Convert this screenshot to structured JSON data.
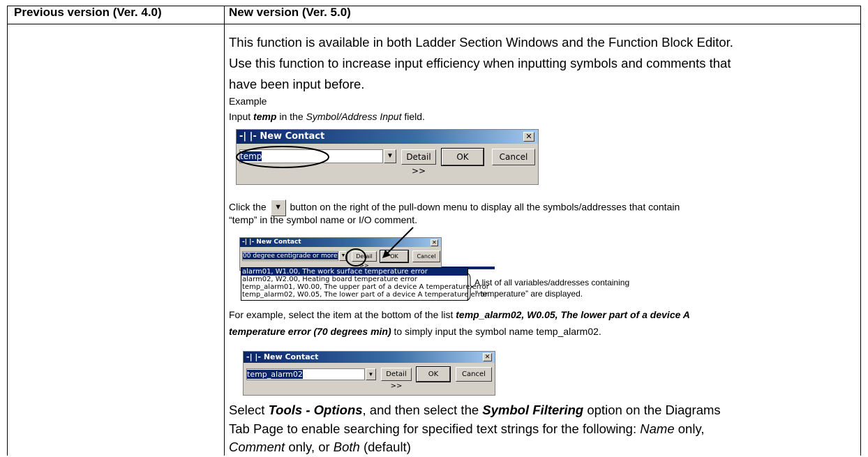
{
  "table": {
    "col_previous": "Previous version (Ver. 4.0)",
    "col_new": "New version (Ver. 5.0)"
  },
  "content": {
    "intro_line1": "This function is available in both Ladder Section Windows and the Function Block Editor.",
    "intro_line2": "Use this function to increase input efficiency when inputting symbols and comments that",
    "intro_line3": "have been input before.",
    "example_label": "Example",
    "input_prefix": "Input ",
    "input_term": "temp",
    "input_mid": " in the ",
    "input_field": "Symbol/Address Input",
    "input_suffix": " field.",
    "click_prefix": "Click the",
    "click_suffix": "button on the right of the pull-down menu to display all the symbols/addresses that contain",
    "click_line2": "“temp” in the symbol name or I/O comment.",
    "list_note_line1": "A list of all variables/addresses containing",
    "list_note_line2": "“ temperature” are displayed.",
    "select_prefix": "For example, select the item at the bottom of the list ",
    "select_bold1": "temp_alarm02, W0.05, The lower part of a device A",
    "select_bold2": "temperature error (70 degrees min)",
    "select_suffix": " to simply input the symbol name temp_alarm02.",
    "tools_prefix": "Select ",
    "tools_bold": "Tools - Options",
    "tools_mid": ", and then select the ",
    "tools_bold2": "Symbol Filtering",
    "tools_suffix": " option on the Diagrams",
    "tab_line": "Tab Page to enable searching for specified text strings for the following: ",
    "name_word": "Name",
    "only1": " only,",
    "comment_word": "Comment",
    "only2": " only, or ",
    "both_word": "Both",
    "default_word": " (default)"
  },
  "dialog1": {
    "title": "-| |- New Contact",
    "input_value": "temp",
    "detail_label": "Detail >>",
    "ok_label": "OK",
    "cancel_label": "Cancel"
  },
  "dialog2": {
    "title": "-| |- New Contact",
    "input_value": "00 degree centigrade or more)",
    "detail_label": "Detail >>",
    "ok_label": "OK",
    "cancel_label": "Cancel",
    "items": [
      "alarm01, W1.00, The work surface temperature error",
      "alarm02, W2.00, Heating board temperature error",
      "temp_alarm01, W0.00, The upper part of a device A temperature error",
      "temp_alarm02, W0.05, The lower part of a device A temperature error"
    ]
  },
  "dialog3": {
    "title": "-| |- New Contact",
    "input_value": "temp_alarm02",
    "detail_label": "Detail >>",
    "ok_label": "OK",
    "cancel_label": "Cancel"
  },
  "icons": {
    "close": "close-icon",
    "dropdown": "dropdown-arrow-icon"
  }
}
